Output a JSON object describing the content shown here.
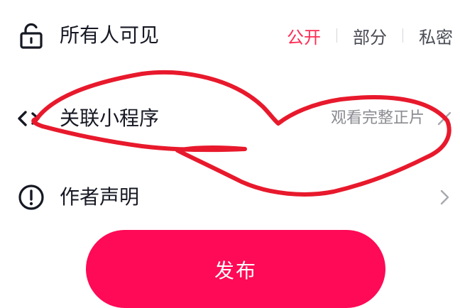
{
  "visibility": {
    "label": "所有人可见",
    "icon": "unlock-icon",
    "options": [
      {
        "label": "公开",
        "active": true
      },
      {
        "label": "部分",
        "active": false
      },
      {
        "label": "私密",
        "active": false
      }
    ]
  },
  "mini_program": {
    "label": "关联小程序",
    "icon": "mini-program-icon",
    "value": "观看完整正片",
    "trailing_icon": "close-icon"
  },
  "author_statement": {
    "label": "作者声明",
    "icon": "exclamation-circle-icon",
    "trailing_icon": "chevron-right-icon"
  },
  "publish_button": {
    "label": "发布"
  },
  "colors": {
    "accent": "#fe2c55",
    "publish_bg": "#fe0a56",
    "annotation": "#e8192c"
  }
}
